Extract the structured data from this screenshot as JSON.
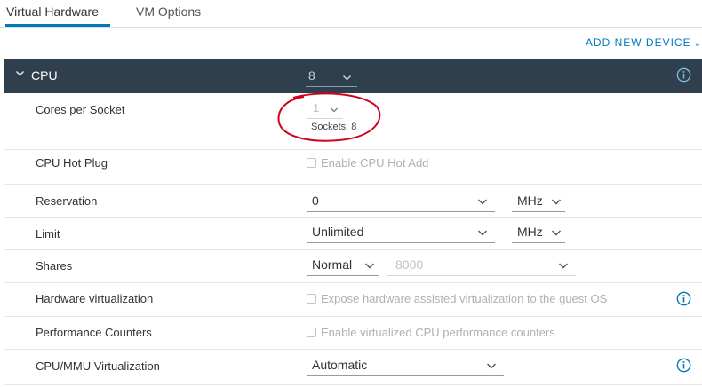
{
  "tabs": [
    {
      "label": "Virtual Hardware",
      "active": true
    },
    {
      "label": "VM Options",
      "active": false
    }
  ],
  "toolbar": {
    "add_device_label": "ADD NEW DEVICE"
  },
  "cpu": {
    "title": "CPU",
    "value": "8"
  },
  "rows": {
    "cores_per_socket": {
      "label": "Cores per Socket",
      "value": "1",
      "sockets_text": "Sockets: 8"
    },
    "hot_plug": {
      "label": "CPU Hot Plug",
      "checkbox_label": "Enable CPU Hot Add",
      "checked": false
    },
    "reservation": {
      "label": "Reservation",
      "value": "0",
      "unit": "MHz"
    },
    "limit": {
      "label": "Limit",
      "value": "Unlimited",
      "unit": "MHz"
    },
    "shares": {
      "label": "Shares",
      "level": "Normal",
      "value": "8000"
    },
    "hw_virt": {
      "label": "Hardware virtualization",
      "checkbox_label": "Expose hardware assisted virtualization to the guest OS",
      "checked": false
    },
    "perf_counters": {
      "label": "Performance Counters",
      "checkbox_label": "Enable virtualized CPU performance counters",
      "checked": false
    },
    "mmu_virt": {
      "label": "CPU/MMU Virtualization",
      "value": "Automatic"
    }
  },
  "colors": {
    "accent": "#0079b8",
    "header_bg": "#2f3f4e",
    "annotation": "#d0021b"
  }
}
